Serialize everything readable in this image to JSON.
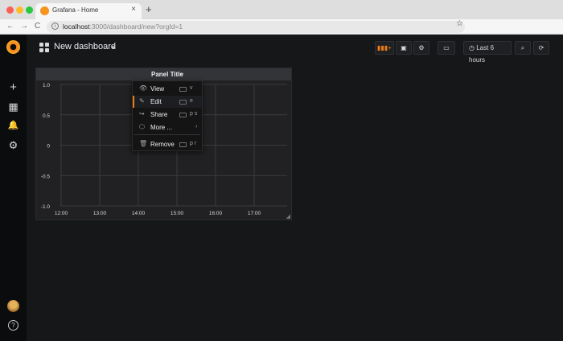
{
  "browser": {
    "tab_title": "Grafana - Home",
    "tab_close": "×",
    "new_tab": "+",
    "url_host": "localhost",
    "url_rest": ":3000/dashboard/new?orgId=1",
    "back_icon": "←",
    "forward_icon": "→",
    "reload_icon": "C",
    "star_icon": "☆"
  },
  "sidemenu": {
    "items": [
      {
        "name": "plus-icon",
        "glyph": "+"
      },
      {
        "name": "dashboards-icon",
        "glyph": "▦"
      },
      {
        "name": "bell-icon",
        "glyph": "🔔"
      },
      {
        "name": "gear-icon",
        "glyph": "⚙"
      }
    ],
    "help": "?"
  },
  "navbar": {
    "dashboard_title": "New dashboard",
    "title_caret": "▾",
    "add_panel_icon": "▮▮▮+",
    "save_icon": "▣",
    "settings_icon": "⚙",
    "tv_icon": "▭",
    "time_picker": "Last 6 hours",
    "clock_icon": "◷",
    "search_icon": "⌕",
    "refresh_icon": "⟳"
  },
  "panel": {
    "title": "Panel Title",
    "caret": "▾",
    "resize": "◢"
  },
  "panel_menu": {
    "items": [
      {
        "label": "View",
        "icon": "👁",
        "key": "v"
      },
      {
        "label": "Edit",
        "icon": "✎",
        "key": "e"
      },
      {
        "label": "Share",
        "icon": "↪",
        "key": "p s"
      },
      {
        "label": "More ...",
        "icon": "⬡",
        "arrow": "›"
      },
      {
        "label": "Remove",
        "icon": "🗑",
        "key": "p r"
      }
    ]
  },
  "chart_data": {
    "type": "line",
    "title": "",
    "x_ticks": [
      "12:00",
      "13:00",
      "14:00",
      "15:00",
      "16:00",
      "17:00"
    ],
    "y_ticks": [
      "1.0",
      "0.5",
      "0",
      "-0.5",
      "-1.0"
    ],
    "y_values": [
      1.0,
      0.5,
      0,
      -0.5,
      -1.0
    ],
    "ylim": [
      -1.0,
      1.0
    ],
    "series": [],
    "grid": true,
    "colors": {
      "grid": "#3a3b3e",
      "tick_text": "#d8d9da",
      "accent": "#eb7b18"
    }
  }
}
